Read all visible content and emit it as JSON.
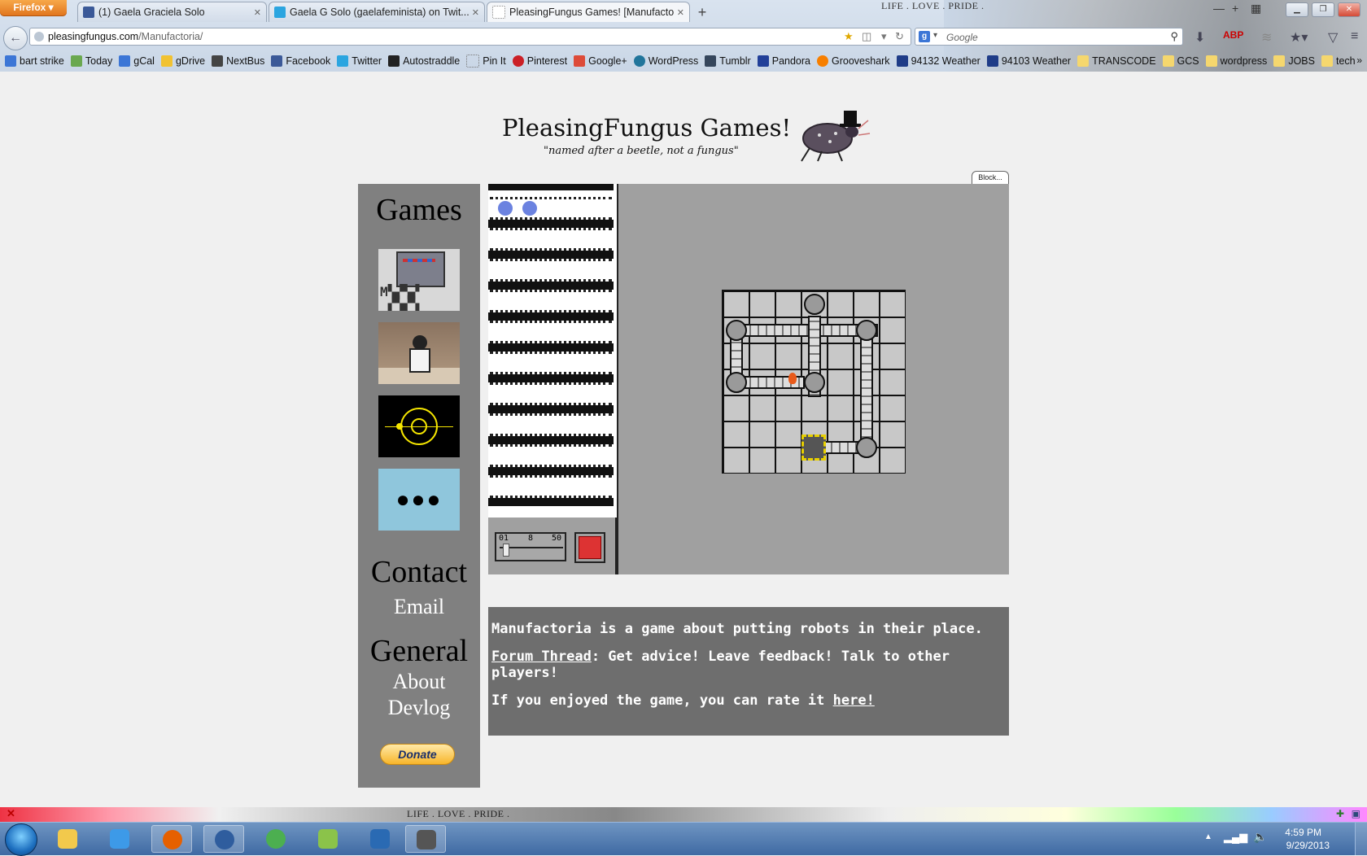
{
  "browser": {
    "menu_button": "Firefox",
    "motto": "LIFE . LOVE . PRIDE .",
    "tabs": [
      {
        "label": "(1) Gaela Graciela Solo",
        "icon": "facebook-icon",
        "color": "#3b5998"
      },
      {
        "label": "Gaela G Solo (gaelafeminista) on Twit...",
        "icon": "twitter-icon",
        "color": "#2ba5e0"
      },
      {
        "label": "PleasingFungus Games! [Manufactoria]",
        "icon": "page-icon",
        "color": "#cccccc"
      }
    ],
    "url_host": "pleasingfungus.com",
    "url_path": "/Manufactoria/",
    "search_placeholder": "Google",
    "bookmarks": [
      {
        "label": "bart strike",
        "color": "#3c76d6"
      },
      {
        "label": "Today",
        "color": "#6aa84f"
      },
      {
        "label": "gCal",
        "color": "#3c76d6"
      },
      {
        "label": "gDrive",
        "color": "#f1c232"
      },
      {
        "label": "NextBus",
        "color": "#444444"
      },
      {
        "label": "Facebook",
        "color": "#3b5998"
      },
      {
        "label": "Twitter",
        "color": "#2ba5e0"
      },
      {
        "label": "Autostraddle",
        "color": "#222222"
      },
      {
        "label": "Pin It",
        "color": "#aaaaaa"
      },
      {
        "label": "Pinterest",
        "color": "#cb2027"
      },
      {
        "label": "Google+",
        "color": "#dd4b39"
      },
      {
        "label": "WordPress",
        "color": "#21759b"
      },
      {
        "label": "Tumblr",
        "color": "#35465c"
      },
      {
        "label": "Pandora",
        "color": "#224099"
      },
      {
        "label": "Grooveshark",
        "color": "#f77f00"
      },
      {
        "label": "94132 Weather",
        "color": "#1f3c88"
      },
      {
        "label": "94103 Weather",
        "color": "#1f3c88"
      },
      {
        "label": "TRANSCODE",
        "color": "#f5d76e"
      },
      {
        "label": "GCS",
        "color": "#f5d76e"
      },
      {
        "label": "wordpress",
        "color": "#f5d76e"
      },
      {
        "label": "JOBS",
        "color": "#f5d76e"
      },
      {
        "label": "tech",
        "color": "#f5d76e"
      }
    ]
  },
  "site": {
    "title": "PleasingFungus Games!",
    "tagline": "\"named after a beetle, not a fungus\""
  },
  "sidebar": {
    "games_heading": "Games",
    "contact_heading": "Contact",
    "email_link": "Email",
    "general_heading": "General",
    "about_link": "About",
    "devlog_link": "Devlog",
    "donate_label": "Donate",
    "game_thumbs": [
      "manufactoria-thumbnail",
      "man-character-thumbnail",
      "orbit-thumbnail",
      "more-games-thumbnail"
    ],
    "more_label": "●●●"
  },
  "game": {
    "block_label": "Block...",
    "speed_ticks": [
      "01",
      "8",
      "50"
    ],
    "tape_items": [
      "blue",
      "blue"
    ],
    "colors": {
      "tape_dot": "#6b82e0",
      "stop": "#dd3333",
      "board": "#a0a0a0"
    }
  },
  "description": {
    "line1": "Manufactoria is a game about putting robots in their place.",
    "forum_link": "Forum Thread",
    "forum_text": ": Get advice! Leave feedback! Talk to other players!",
    "rate_text": "If you enjoyed the game, you can rate it ",
    "rate_link": "here!"
  },
  "statusbar": {
    "motto": "LIFE . LOVE . PRIDE ."
  },
  "taskbar": {
    "apps": [
      {
        "name": "explorer",
        "color": "#f2c94c"
      },
      {
        "name": "dropbox",
        "color": "#3d9ae8"
      },
      {
        "name": "firefox",
        "color": "#e66000"
      },
      {
        "name": "thunderbird",
        "color": "#2f5d9e"
      },
      {
        "name": "chrome",
        "color": "#4caf50"
      },
      {
        "name": "tree-app",
        "color": "#8bc34a"
      },
      {
        "name": "powershell",
        "color": "#2a6ab3"
      },
      {
        "name": "sublime",
        "color": "#555555"
      }
    ],
    "time": "4:59 PM",
    "date": "9/29/2013"
  }
}
